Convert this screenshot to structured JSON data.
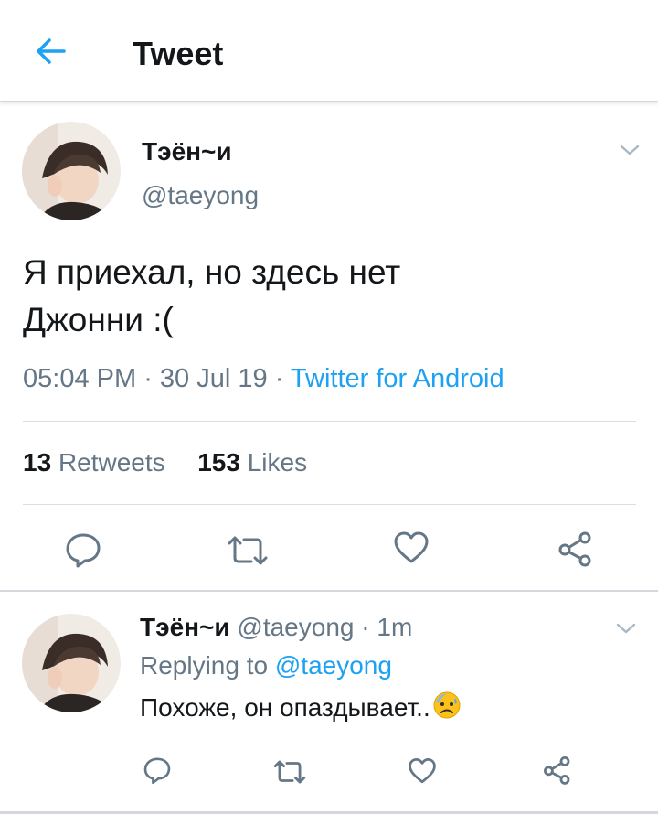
{
  "colors": {
    "accent": "#1da1f2",
    "muted": "#657786",
    "text": "#14171a",
    "divider": "#d9dee2"
  },
  "header": {
    "title": "Tweet",
    "back_icon": "arrow-left-icon"
  },
  "tweet": {
    "display_name": "Тэён~и",
    "handle": "@taeyong",
    "text_line1": "Я приехал, но здесь нет",
    "text_line2": "Джонни :(",
    "time": "05:04 PM",
    "date": "30 Jul 19",
    "source": "Twitter for Android",
    "retweets_count": "13",
    "retweets_label": "Retweets",
    "likes_count": "153",
    "likes_label": "Likes",
    "actions": [
      "reply-icon",
      "retweet-icon",
      "heart-icon",
      "share-icon"
    ]
  },
  "reply": {
    "display_name": "Тэён~и",
    "handle": "@taeyong",
    "age": "1m",
    "replying_prefix": "Replying to",
    "replying_to": "@taeyong",
    "text": "Похоже, он опаздывает..",
    "emoji": "sad-sweat-face-emoji"
  }
}
